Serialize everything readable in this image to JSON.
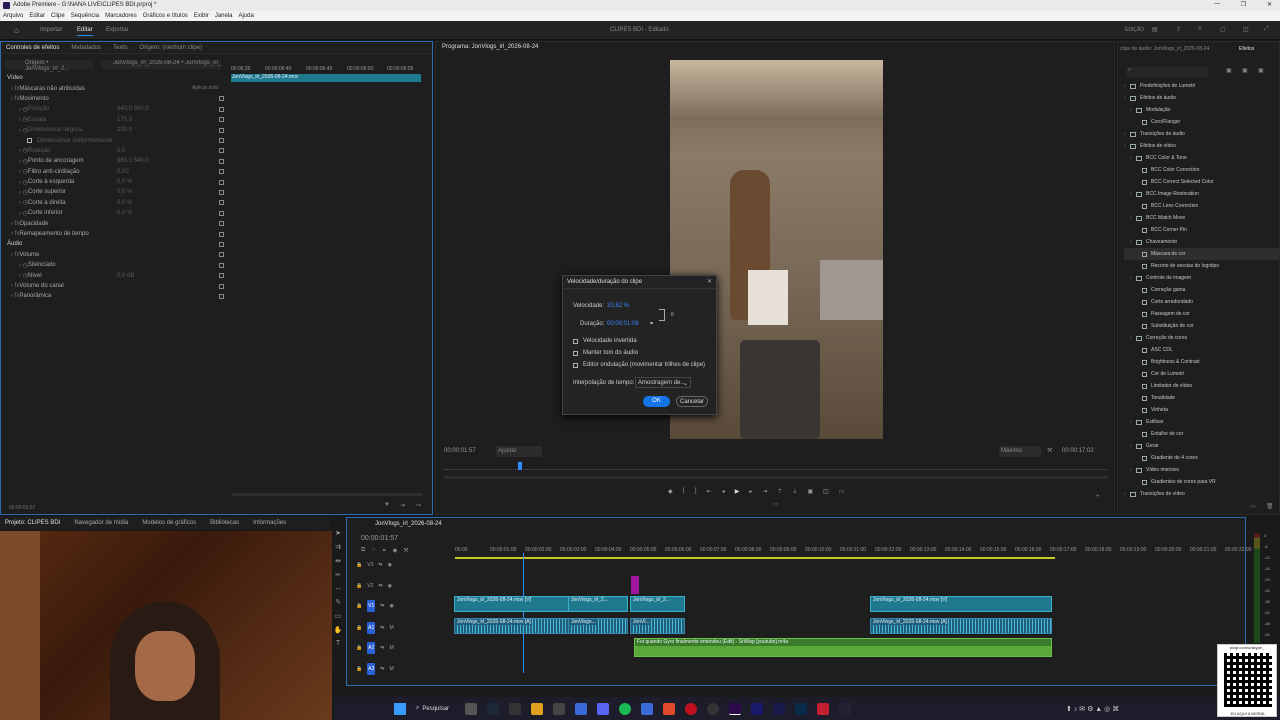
{
  "title_bar": {
    "app_title": "Adobe Premiere - G:\\NANA LIVE\\CLIPES BDI.prproj *"
  },
  "menu": [
    "Arquivo",
    "Editar",
    "Clipe",
    "Sequência",
    "Marcadores",
    "Gráficos e títulos",
    "Exibir",
    "Janela",
    "Ajuda"
  ],
  "workspace": {
    "tabs": [
      "Importar",
      "Editar",
      "Exportar"
    ],
    "active": "Editar",
    "project_title": "CLIPES BDI - Editado",
    "mode": "EDIÇÃO"
  },
  "effect_controls": {
    "tabs": [
      "Controles de efeitos",
      "Metadados",
      "Texto",
      "Origem: (nenhum clipe)"
    ],
    "source": "Origem • JonVlogs_irl_2...",
    "seq": "JonVlogs_irl_2026-08-24 • JonVlogs_irl_2...",
    "times": [
      "00;06;35",
      "00:00:06:40",
      "00:00:06:45",
      "00:00:06:50",
      "00:00:06:55"
    ],
    "clip_bar": "JonVlogs_irl_2026-08-24.mov",
    "apply_label": "Aplicar todo",
    "rows": [
      {
        "label": "Vídeo",
        "indent": 0,
        "dim": false,
        "val": ""
      },
      {
        "label": "Máscaras não atribuídas",
        "indent": 1,
        "dim": false,
        "val": ""
      },
      {
        "label": "Movimento",
        "indent": 1,
        "dim": false,
        "val": ""
      },
      {
        "label": "Posição",
        "indent": 3,
        "dim": true,
        "val": "540,0   960,0"
      },
      {
        "label": "Escala",
        "indent": 3,
        "dim": true,
        "val": "175,0"
      },
      {
        "label": "Dimensionar largura",
        "indent": 3,
        "dim": true,
        "val": "100,0"
      },
      {
        "label": "Dimensionar uniformemente",
        "indent": 5,
        "dim": true,
        "val": ""
      },
      {
        "label": "Rotação",
        "indent": 3,
        "dim": true,
        "val": "0,0"
      },
      {
        "label": "Ponto de ancoragem",
        "indent": 3,
        "dim": false,
        "val": "960,0   540,0"
      },
      {
        "label": "Filtro anti-cintilação",
        "indent": 3,
        "dim": false,
        "val": "0,00"
      },
      {
        "label": "Corte à esquerda",
        "indent": 3,
        "dim": false,
        "val": "0,0 %"
      },
      {
        "label": "Corte superior",
        "indent": 3,
        "dim": false,
        "val": "0,0 %"
      },
      {
        "label": "Corte à direita",
        "indent": 3,
        "dim": false,
        "val": "0,0 %"
      },
      {
        "label": "Corte inferior",
        "indent": 3,
        "dim": false,
        "val": "0,0 %"
      },
      {
        "label": "Opacidade",
        "indent": 1,
        "dim": false,
        "val": ""
      },
      {
        "label": "Remapeamento de tempo",
        "indent": 1,
        "dim": false,
        "val": ""
      },
      {
        "label": "Áudio",
        "indent": 0,
        "dim": false,
        "val": ""
      },
      {
        "label": "Volume",
        "indent": 1,
        "dim": false,
        "val": ""
      },
      {
        "label": "Silenciado",
        "indent": 3,
        "dim": false,
        "val": ""
      },
      {
        "label": "Nível",
        "indent": 3,
        "dim": false,
        "val": "0,0 dB"
      },
      {
        "label": "Volume do canal",
        "indent": 1,
        "dim": false,
        "val": ""
      },
      {
        "label": "Panorâmica",
        "indent": 1,
        "dim": false,
        "val": ""
      }
    ],
    "footer_time": "00:00:01:57"
  },
  "program": {
    "tab": "Programa: JonVlogs_irl_2026-08-24",
    "timecode": "00:00:01:57",
    "fit": "Ajustar",
    "quality": "Máximo",
    "duration": "00:00:17:02"
  },
  "dialog": {
    "title": "Velocidade/duração do clipe",
    "speed_label": "Velocidade:",
    "speed": "33,82 %",
    "duration_label": "Duração:",
    "duration": "00:00:01:08",
    "checks": [
      "Velocidade invertida",
      "Manter tom do áudio",
      "Editor ondulação (movimentar trilhes de clipe)"
    ],
    "interp_label": "Interpolação de tempo:",
    "interp": "Amostragem de...",
    "ok": "OK",
    "cancel": "Cancelar"
  },
  "effects": {
    "source": "clipe de áudio: JonVlogs_irl_2026-08-24",
    "tab": "Efeitos",
    "items": [
      {
        "label": "Predefinições de Lumetri",
        "lvl": 0,
        "kind": "folder"
      },
      {
        "label": "Efeitos de áudio",
        "lvl": 0,
        "kind": "folder"
      },
      {
        "label": "Modulação",
        "lvl": 1,
        "kind": "folder"
      },
      {
        "label": "Coro/Flanger",
        "lvl": 2,
        "kind": "preset"
      },
      {
        "label": "Transições de áudio",
        "lvl": 0,
        "kind": "folder"
      },
      {
        "label": "Efeitos de vídeo",
        "lvl": 0,
        "kind": "folder"
      },
      {
        "label": "BCC Color & Tone",
        "lvl": 1,
        "kind": "folder"
      },
      {
        "label": "BCC Color Correction",
        "lvl": 2,
        "kind": "preset"
      },
      {
        "label": "BCC Correct Selected Color",
        "lvl": 2,
        "kind": "preset"
      },
      {
        "label": "BCC Image Restoration",
        "lvl": 1,
        "kind": "folder"
      },
      {
        "label": "BCC Lens Correction",
        "lvl": 2,
        "kind": "preset"
      },
      {
        "label": "BCC Match Move",
        "lvl": 1,
        "kind": "folder"
      },
      {
        "label": "BCC Corner Pin",
        "lvl": 2,
        "kind": "preset"
      },
      {
        "label": "Chaveamento",
        "lvl": 1,
        "kind": "folder"
      },
      {
        "label": "Máscara de cor",
        "lvl": 2,
        "kind": "preset"
      },
      {
        "label": "Recorte de arestas do logotipo",
        "lvl": 2,
        "kind": "preset"
      },
      {
        "label": "Controle de imagem",
        "lvl": 1,
        "kind": "folder"
      },
      {
        "label": "Correção gama",
        "lvl": 2,
        "kind": "preset"
      },
      {
        "label": "Corte arredondado",
        "lvl": 2,
        "kind": "preset"
      },
      {
        "label": "Passagem de cor",
        "lvl": 2,
        "kind": "preset"
      },
      {
        "label": "Substituição de cor",
        "lvl": 2,
        "kind": "preset"
      },
      {
        "label": "Correção de cores",
        "lvl": 1,
        "kind": "folder"
      },
      {
        "label": "ASC CDL",
        "lvl": 2,
        "kind": "preset"
      },
      {
        "label": "Brightness & Contrast",
        "lvl": 2,
        "kind": "preset"
      },
      {
        "label": "Cor de Lumetri",
        "lvl": 2,
        "kind": "preset"
      },
      {
        "label": "Limitador de vídeo",
        "lvl": 2,
        "kind": "preset"
      },
      {
        "label": "Tonalidade",
        "lvl": 2,
        "kind": "preset"
      },
      {
        "label": "Vinheta",
        "lvl": 2,
        "kind": "preset"
      },
      {
        "label": "Estilizar",
        "lvl": 1,
        "kind": "folder"
      },
      {
        "label": "Entalhe de cor",
        "lvl": 2,
        "kind": "preset"
      },
      {
        "label": "Gerar",
        "lvl": 1,
        "kind": "folder"
      },
      {
        "label": "Gradiente de 4 cores",
        "lvl": 2,
        "kind": "preset"
      },
      {
        "label": "Vídeo imersivo",
        "lvl": 1,
        "kind": "folder"
      },
      {
        "label": "Gradientes de cores para VR",
        "lvl": 2,
        "kind": "preset"
      },
      {
        "label": "Transições de vídeo",
        "lvl": 0,
        "kind": "folder"
      }
    ]
  },
  "project": {
    "tabs": [
      "Projeto: CLIPES BDI",
      "Navegador de mídia",
      "Modelos de gráficos",
      "Bibliotecas",
      "Informações"
    ]
  },
  "timeline": {
    "tab": "JonVlogs_irl_2026-08-24",
    "timecode": "00:00:01:57",
    "ruler": [
      "00:00",
      "00:00:01:00",
      "00:00:02:00",
      "00:00:03:00",
      "00:00:04:00",
      "00:00:05:00",
      "00:00:06:00",
      "00:00:07:00",
      "00:00:08:00",
      "00:00:09:00",
      "00:00:10:00",
      "00:00:11:00",
      "00:00:12:00",
      "00:00:13:00",
      "00:00:14:00",
      "00:00:15:00",
      "00:00:16:00",
      "00:00:17:00",
      "00:00:18:00",
      "00:00:19:00",
      "00:00:20:00",
      "00:00:21:00",
      "00:00:22:00"
    ],
    "tracks": [
      "V3",
      "V2",
      "V1",
      "A1",
      "A2",
      "A3"
    ],
    "clips_v": [
      "JonVlogs_irl_2026-08-24.mov [V]",
      "JonVlogs_irl_2...",
      "JonVlogs_irl_2...",
      "JonVlogs_irl_2026-08-24.mov [V]"
    ],
    "clips_a": [
      "JonVlogs_irl_2026-08-24.mov [A]",
      "JonVlogs...",
      "JonVl...",
      "JonVlogs_irl_2026-08-24.mov [A]"
    ],
    "music": "Foi quando Gyro finalmente entendeu (Edit) - SrWisp [youtube].m4a",
    "meter": [
      "0",
      "-6",
      "-12",
      "-18",
      "-24",
      "-30",
      "-36",
      "-42",
      "-48",
      "-54"
    ]
  },
  "taskbar": {
    "search": "Pesquisar",
    "qr_text": "pixqr.com/u/skype_",
    "qr_caption": "EU AQUI A MORAL"
  },
  "colors": {
    "accent": "#2d8cff",
    "clip_video": "#1f7a8f",
    "clip_music": "#3a7a2a",
    "panel_border": "#2d6cb5"
  }
}
